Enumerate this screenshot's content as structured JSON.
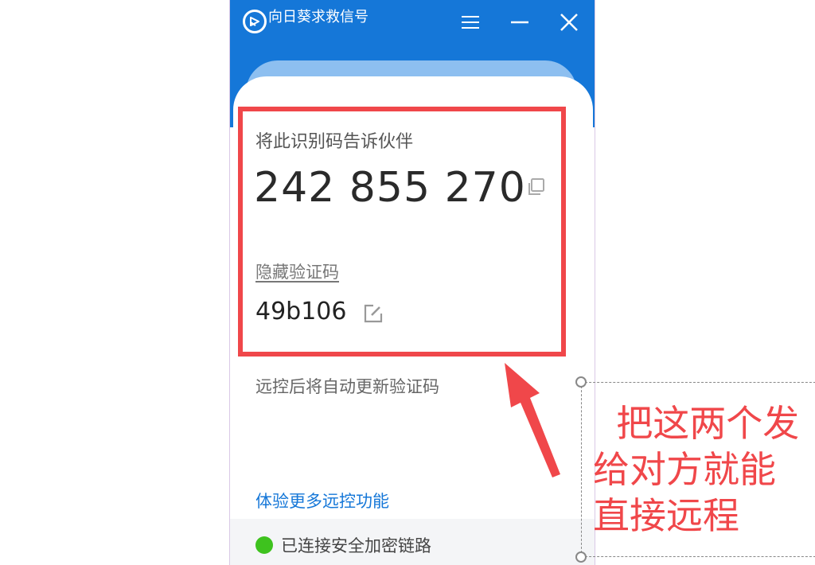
{
  "window": {
    "title": "向日葵求救信号",
    "menu_icon": "menu-icon",
    "minimize_icon": "minimize-icon",
    "close_icon": "close-icon"
  },
  "identity": {
    "label": "将此识别码告诉伙伴",
    "id_number": "242 855 270",
    "copy_icon": "copy-icon"
  },
  "verification": {
    "hide_label": "隐藏验证码",
    "code": "49b106",
    "edit_icon": "edit-icon",
    "auto_update_note": "远控后将自动更新验证码"
  },
  "links": {
    "more_features": "体验更多远控功能"
  },
  "status": {
    "text": "已连接安全加密链路",
    "color": "#3ec21e"
  },
  "annotation": {
    "note": "  把这两个发\n给对方就能\n直接远程",
    "color": "#f0474a"
  },
  "colors": {
    "brand_blue": "#1577d8",
    "accent_red": "#f0474a"
  }
}
